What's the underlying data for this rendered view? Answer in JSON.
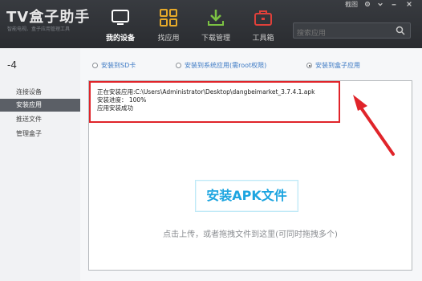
{
  "app": {
    "logo": "TV盒子助手",
    "slogan": "智能电视、盒子应用管理工具"
  },
  "window_controls": {
    "screenshot": "截图",
    "settings_icon": "gear-icon",
    "minimize_icon": "minimize-icon",
    "close_icon": "close-icon"
  },
  "nav": [
    {
      "label": "我的设备",
      "icon": "tv-icon",
      "active": true
    },
    {
      "label": "找应用",
      "icon": "grid-icon",
      "active": false
    },
    {
      "label": "下载管理",
      "icon": "download-icon",
      "active": false
    },
    {
      "label": "工具箱",
      "icon": "toolbox-icon",
      "active": false
    }
  ],
  "search": {
    "placeholder": "搜索应用"
  },
  "sidebar": {
    "title": "-4",
    "items": [
      {
        "label": "连接设备",
        "active": false
      },
      {
        "label": "安装应用",
        "active": true
      },
      {
        "label": "推送文件",
        "active": false
      },
      {
        "label": "管理盒子",
        "active": false
      }
    ]
  },
  "install_options": [
    {
      "label": "安装到SD卡",
      "selected": false
    },
    {
      "label": "安装到系统应用(需root权限)",
      "selected": false
    },
    {
      "label": "安装到盒子应用",
      "selected": true
    }
  ],
  "log": [
    "正在安装应用:C:\\Users\\Administrator\\Desktop\\dangbeimarket_3.7.4.1.apk",
    "安装进度： 100%",
    "应用安装成功"
  ],
  "install_button": "安装APK文件",
  "hint": "点击上传，或者拖拽文件到这里(可同时拖拽多个)",
  "colors": {
    "accent": "#1da5e0",
    "highlight": "#e0242a",
    "topbar": "#2f3236",
    "link": "#3c79c4"
  }
}
